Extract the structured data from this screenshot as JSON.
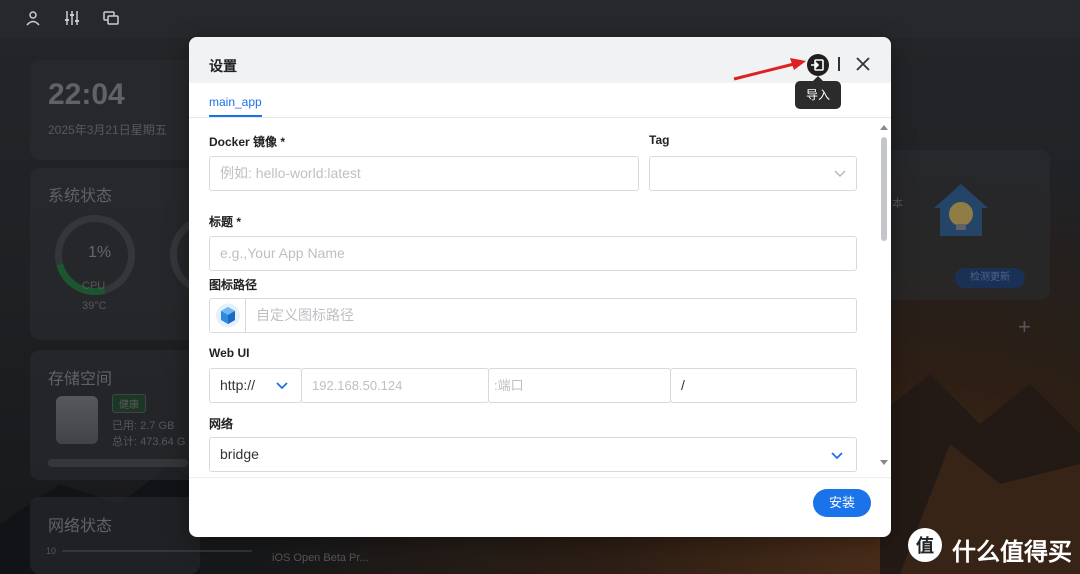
{
  "background": {
    "clock": {
      "time": "22:04",
      "date": "2025年3月21日星期五"
    },
    "system_status": {
      "title": "系统状态",
      "cpu_value": "1%",
      "cpu_label": "CPU",
      "cpu_temp": "39°C"
    },
    "storage": {
      "title": "存储空间",
      "badge": "健康",
      "used": "已用: 2.7 GB",
      "total": "总计: 473.64 G"
    },
    "network": {
      "title": "网络状态",
      "value": "10",
      "app_text": "iOS Open Beta Pr..."
    },
    "right_card": {
      "side_text": "本",
      "button": "检测更新"
    }
  },
  "dialog": {
    "title": "设置",
    "tooltip": "导入",
    "tab": "main_app",
    "fields": {
      "docker_image": {
        "label": "Docker 镜像 *",
        "placeholder": "例如: hello-world:latest"
      },
      "tag": {
        "label": "Tag",
        "value": ""
      },
      "title": {
        "label": "标题 *",
        "placeholder": "e.g.,Your App Name"
      },
      "icon_path": {
        "label": "图标路径",
        "placeholder": "自定义图标路径"
      },
      "web_ui": {
        "label": "Web UI",
        "protocol": "http://",
        "host_placeholder": "192.168.50.124",
        "port_placeholder": ":端口",
        "path_value": "/"
      },
      "network": {
        "label": "网络",
        "value": "bridge"
      }
    },
    "install_label": "安装"
  },
  "colors": {
    "accent": "#1a73e8",
    "annotation": "#e02020"
  },
  "watermark": {
    "text": "什么值得买"
  }
}
